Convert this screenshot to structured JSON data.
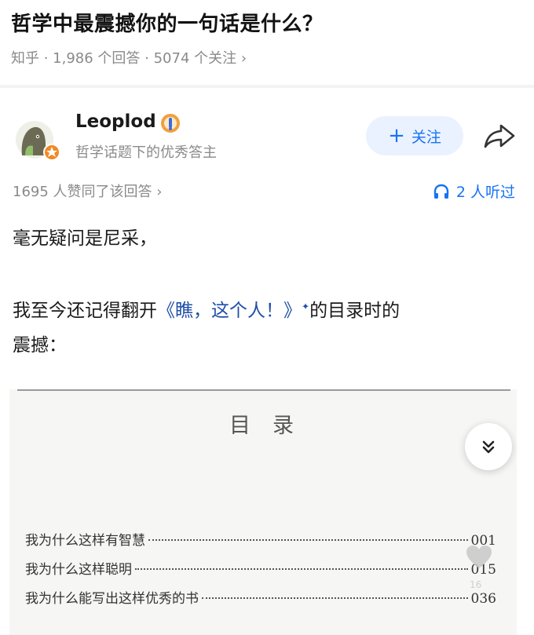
{
  "question": {
    "title": "哲学中最震撼你的一句话是什么？",
    "meta": "知乎 · 1,986 个回答 · 5074 个关注 ›"
  },
  "author": {
    "name": "Leoplod",
    "description": "哲学话题下的优秀答主",
    "follow_label": "关注",
    "follow_plus": "+"
  },
  "answer_stats": {
    "upvotes": "1695 人赞同了该回答 ›",
    "listeners": "2 人听过"
  },
  "answer": {
    "line1": "毫无疑问是尼采，",
    "line2_before": "我至今还记得翻开",
    "book_title": "《瞧，这个人！》",
    "spark": "✦",
    "line2_after": "的目录时的",
    "line3": "震撼："
  },
  "toc": {
    "title": "目录",
    "entries": [
      {
        "text": "我为什么这样有智慧",
        "page": "001"
      },
      {
        "text": "我为什么这样聪明",
        "page": "015"
      },
      {
        "text": "我为什么能写出这样优秀的书",
        "page": "036"
      }
    ]
  },
  "overlay": {
    "heart_count": "16"
  },
  "colors": {
    "accent": "#1772f6",
    "link": "#1f4fa8",
    "muted": "#8a8a8a"
  },
  "icons": [
    "share-icon",
    "headphone-icon",
    "chevron-double-down-icon",
    "heart-icon",
    "badge-icon",
    "avatar"
  ]
}
